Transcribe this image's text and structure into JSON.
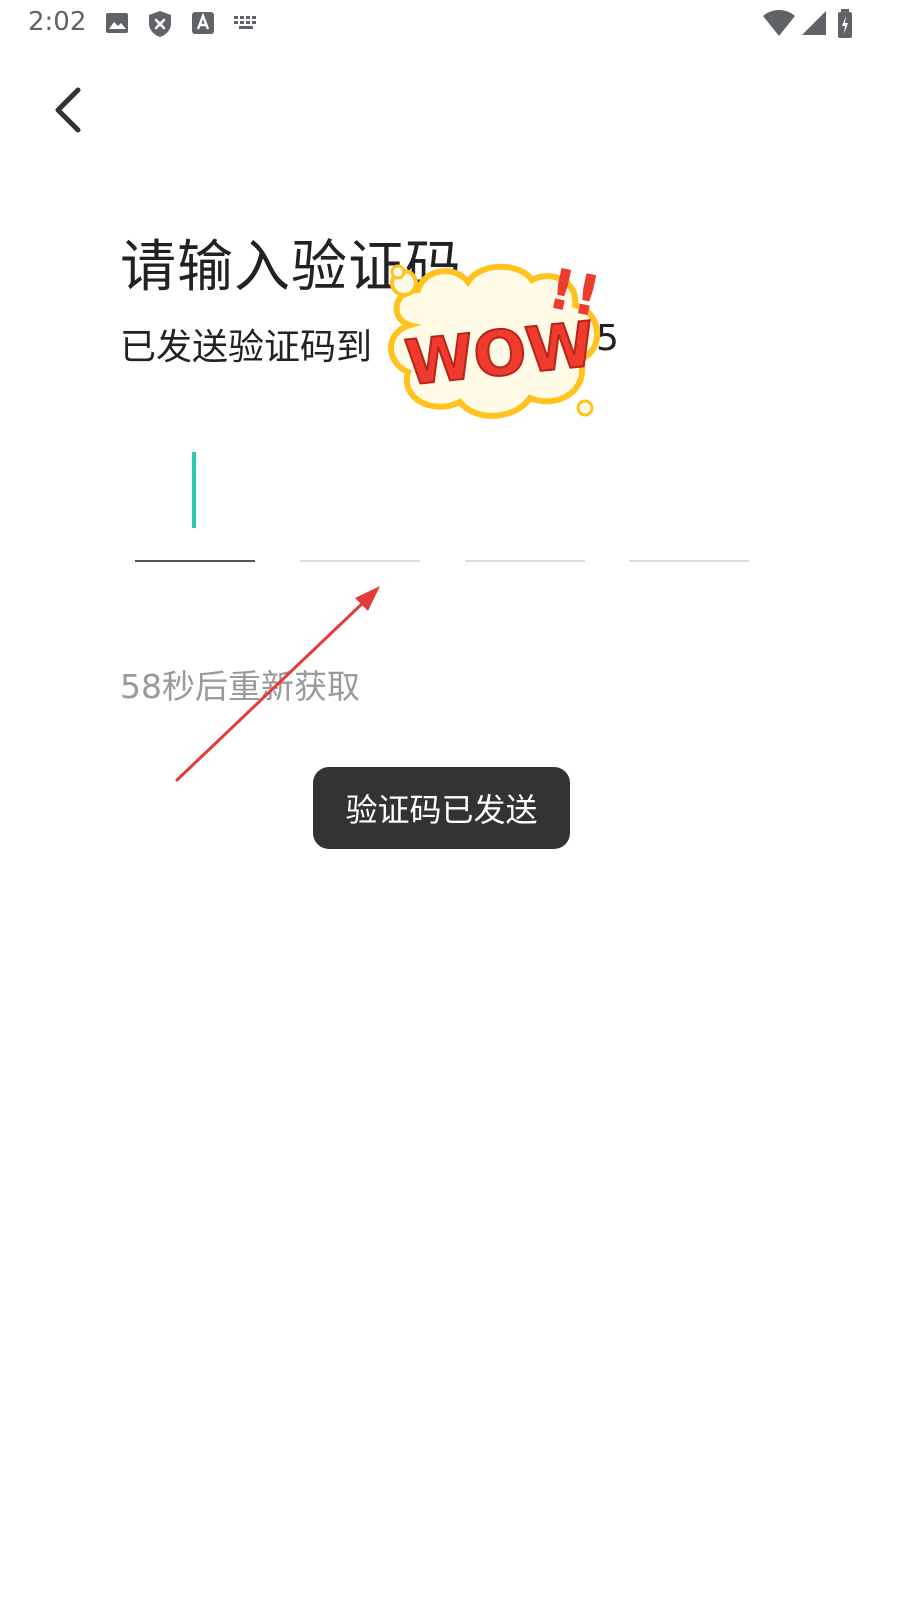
{
  "status_bar": {
    "time": "2:02",
    "left_icons": [
      "image-icon",
      "shield-x-icon",
      "text-a-icon",
      "keyboard-icon"
    ],
    "right_icons": [
      "wifi-icon",
      "signal-icon",
      "battery-charging-icon"
    ]
  },
  "nav": {
    "back_icon": "chevron-left-icon"
  },
  "main": {
    "title": "请输入验证码",
    "subtitle": "已发送验证码到",
    "phone_tail": "5",
    "code_inputs": [
      {
        "value": "",
        "active": true
      },
      {
        "value": "",
        "active": false
      },
      {
        "value": "",
        "active": false
      },
      {
        "value": "",
        "active": false
      }
    ],
    "resend": "58秒后重新获取"
  },
  "toast": {
    "text": "验证码已发送"
  },
  "sticker": {
    "text": "WOW",
    "marks": "!!"
  },
  "colors": {
    "caret": "#2ec7b2",
    "toast_bg": "#333333",
    "resend_gray": "#9a9a9a",
    "arrow_red": "#e53a3a",
    "wow_red": "#ee3b2e",
    "wow_yellow": "#ffd21f"
  }
}
